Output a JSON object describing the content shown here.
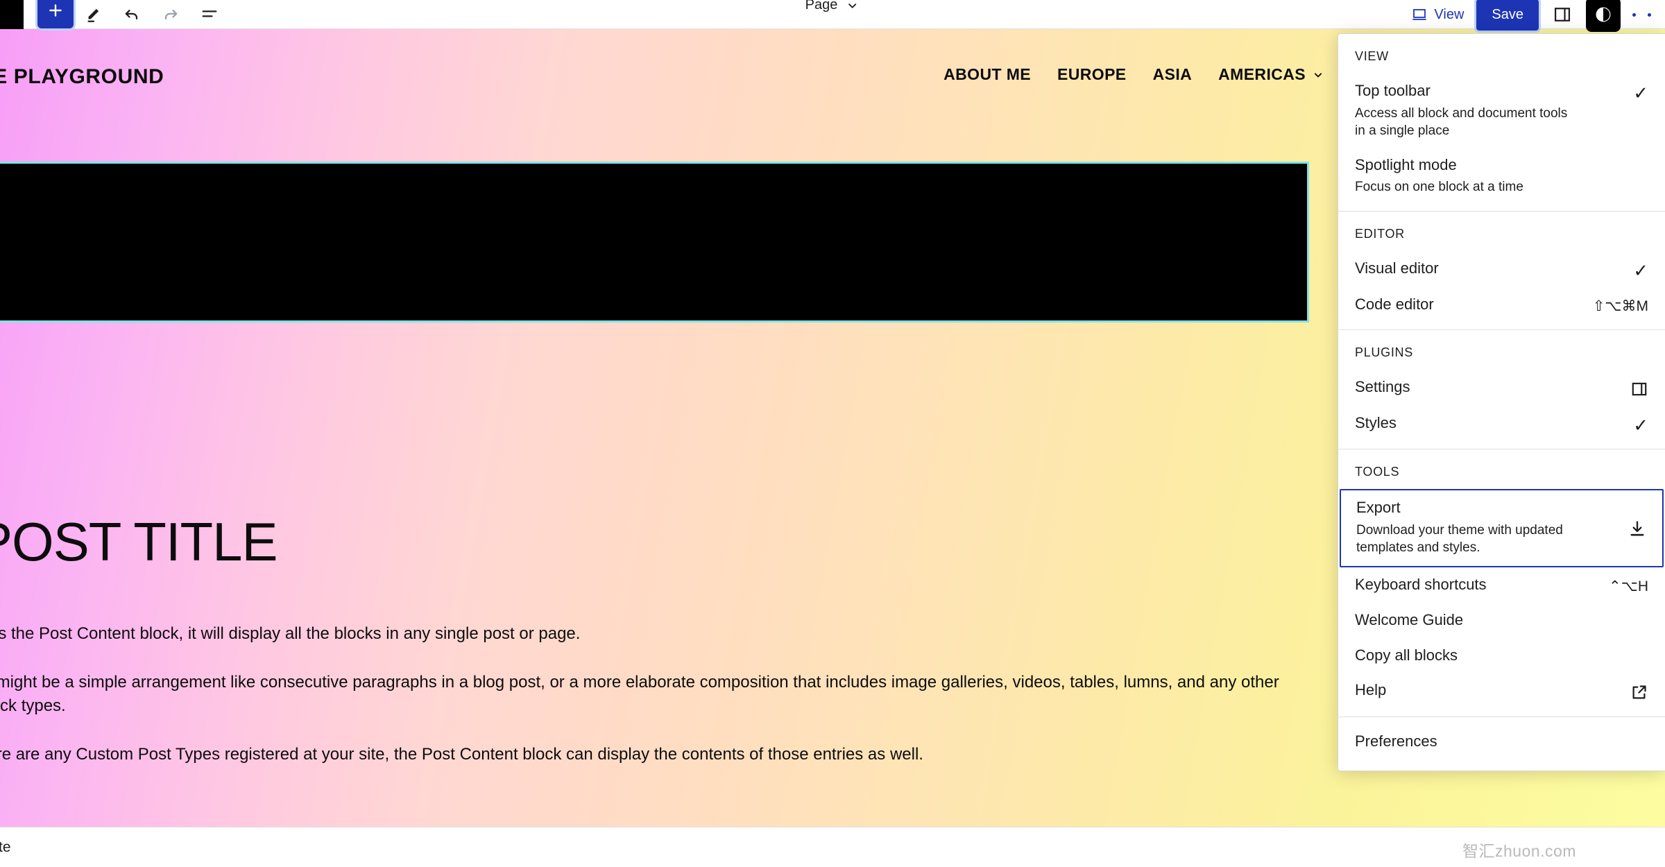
{
  "toolbar": {
    "inserter_label": "Add block",
    "tools_label": "Tools",
    "undo_label": "Undo",
    "redo_label": "Redo",
    "list_view_label": "Document Overview",
    "doc_type": "Page",
    "view_label": "View",
    "save_label": "Save",
    "settings_label": "Settings",
    "styles_label": "Styles",
    "options_label": "Options",
    "accent_color": "#1d35b4"
  },
  "site": {
    "title": "HE PLAYGROUND",
    "nav": [
      {
        "label": "ABOUT ME",
        "has_submenu": false
      },
      {
        "label": "EUROPE",
        "has_submenu": false
      },
      {
        "label": "ASIA",
        "has_submenu": false
      },
      {
        "label": "AMERICAS",
        "has_submenu": true
      }
    ],
    "post_title": "POST TITLE",
    "paragraphs": [
      "is is the Post Content block, it will display all the blocks in any single post or page.",
      "at might be a simple arrangement like consecutive paragraphs in a blog post, or a more elaborate composition that includes image galleries, videos, tables, lumns, and any other block types.",
      "here are any Custom Post Types registered at your site, the Post Content block can display the contents of those entries as well."
    ],
    "cover_block_color": "#000000",
    "selection_color": "#7fe3e8"
  },
  "statusbar": {
    "text": "plate"
  },
  "watermark": {
    "text": "智汇zhuon.com"
  },
  "menu": {
    "groups": [
      {
        "label": "VIEW",
        "items": [
          {
            "title": "Top toolbar",
            "desc": "Access all block and document tools in a single place",
            "right": "check",
            "shortcut": ""
          },
          {
            "title": "Spotlight mode",
            "desc": "Focus on one block at a time",
            "right": "",
            "shortcut": ""
          }
        ]
      },
      {
        "label": "EDITOR",
        "items": [
          {
            "title": "Visual editor",
            "desc": "",
            "right": "check",
            "shortcut": ""
          },
          {
            "title": "Code editor",
            "desc": "",
            "right": "shortcut",
            "shortcut": "⇧⌥⌘M"
          }
        ]
      },
      {
        "label": "PLUGINS",
        "items": [
          {
            "title": "Settings",
            "desc": "",
            "right": "sidebar-icon",
            "shortcut": ""
          },
          {
            "title": "Styles",
            "desc": "",
            "right": "check",
            "shortcut": ""
          }
        ]
      },
      {
        "label": "TOOLS",
        "items": [
          {
            "title": "Export",
            "desc": "Download your theme with updated templates and styles.",
            "right": "download-icon",
            "shortcut": "",
            "focused": true
          },
          {
            "title": "Keyboard shortcuts",
            "desc": "",
            "right": "shortcut",
            "shortcut": "⌃⌥H"
          },
          {
            "title": "Welcome Guide",
            "desc": "",
            "right": "",
            "shortcut": ""
          },
          {
            "title": "Copy all blocks",
            "desc": "",
            "right": "",
            "shortcut": ""
          },
          {
            "title": "Help",
            "desc": "",
            "right": "external-icon",
            "shortcut": ""
          }
        ]
      },
      {
        "label": "",
        "items": [
          {
            "title": "Preferences",
            "desc": "",
            "right": "",
            "shortcut": ""
          }
        ]
      }
    ]
  }
}
